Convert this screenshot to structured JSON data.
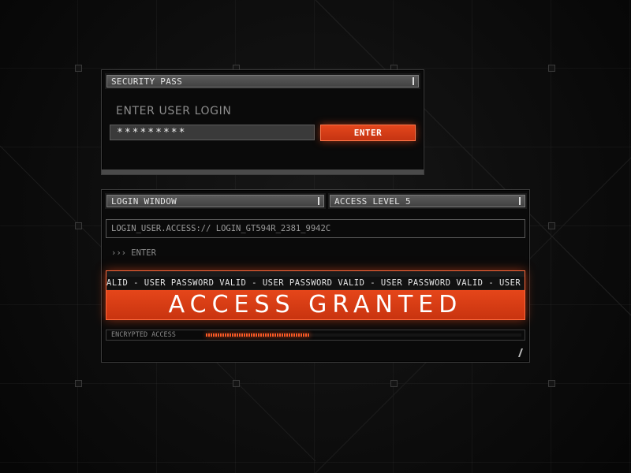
{
  "security_pass": {
    "title": "SECURITY PASS",
    "login_label": "ENTER USER LOGIN",
    "password_value": "*********",
    "enter_label": "ENTER"
  },
  "login_window": {
    "title": "LOGIN WINDOW",
    "access_level": "ACCESS LEVEL 5",
    "access_string": "LOGIN_USER.ACCESS:// LOGIN_GT594R_2381_9942C",
    "prompt": "››› ENTER",
    "scroll_text": "ALID - USER PASSWORD VALID - USER PASSWORD VALID - USER PASSWORD VALID - USER PASS",
    "banner": "ACCESS GRANTED",
    "progress_label": "ENCRYPTED ACCESS",
    "progress_fraction": 0.33
  },
  "colors": {
    "accent": "#e4461c",
    "accent_glow": "#ff6a3c",
    "panel_bg": "#0a0a0a",
    "titlebar": "#4a4a4a"
  }
}
